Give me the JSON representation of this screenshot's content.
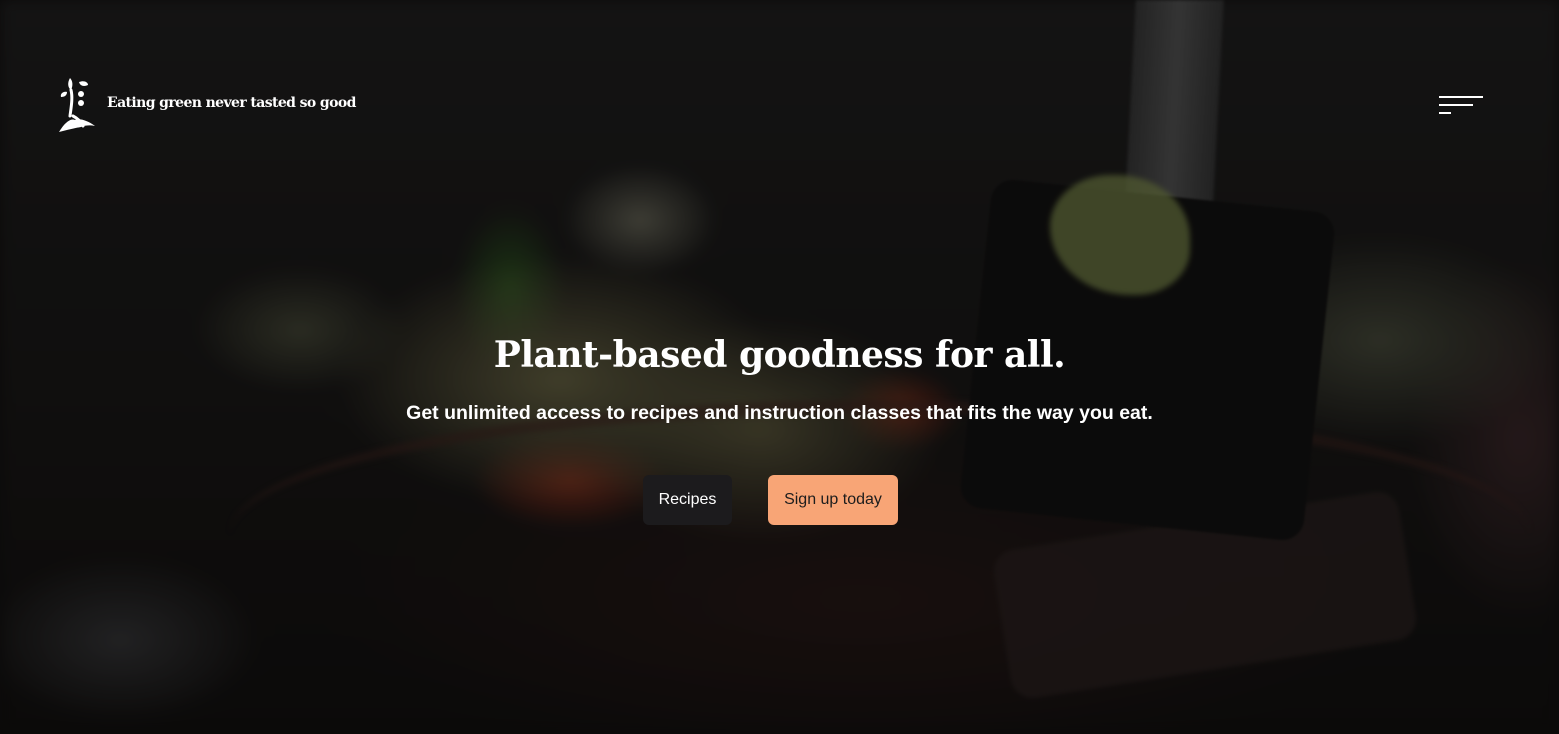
{
  "header": {
    "logo_icon": "plant-figure-icon",
    "tagline": "Eating green never tasted so good",
    "menu_icon": "hamburger-menu-icon"
  },
  "hero": {
    "title": "Plant-based goodness for all.",
    "subtitle": "Get unlimited access to recipes and instruction classes that fits the way you eat.",
    "buttons": {
      "recipes_label": "Recipes",
      "signup_label": "Sign up today"
    }
  },
  "colors": {
    "signup_button": "#f8a576",
    "recipes_button": "#1c1b1d",
    "text": "#ffffff"
  }
}
